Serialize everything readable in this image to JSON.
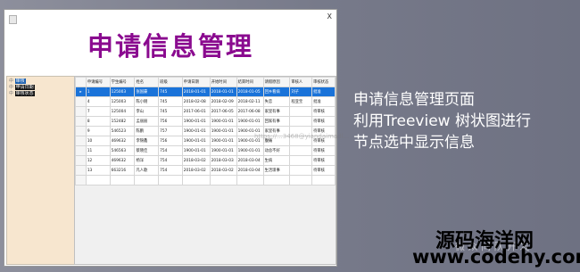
{
  "window": {
    "close_glyph": "X",
    "banner_title": "申请信息管理"
  },
  "tree": {
    "nodes": [
      {
        "label": "审核",
        "prefix": "中"
      },
      {
        "label": "申请日期",
        "prefix": "中"
      },
      {
        "label": "审核状态",
        "prefix": "中"
      }
    ]
  },
  "table": {
    "columns": [
      "申请编号",
      "学生编号",
      "姓名",
      "班级",
      "申请日期",
      "开始时间",
      "结束时间",
      "请假原因",
      "审核人",
      "审核状态"
    ],
    "rows": [
      {
        "selected": true,
        "marker": "▸",
        "cells": [
          "1",
          "125003",
          "张国豪",
          "745",
          "2018-01-01",
          "2018-01-01",
          "2018-01-05",
          "回乡看病",
          "刘子",
          "批准"
        ]
      },
      {
        "selected": false,
        "marker": "",
        "cells": [
          "4",
          "125003",
          "陈小刚",
          "745",
          "2018-02-08",
          "2018-02-09",
          "2018-02-11",
          "失恋",
          "程亚宝",
          "批准"
        ]
      },
      {
        "selected": false,
        "marker": "",
        "cells": [
          "7",
          "125004",
          "李山",
          "745",
          "2017-06-01",
          "2017-06-05",
          "2017-06-08",
          "家里有事",
          "",
          "待审核"
        ]
      },
      {
        "selected": false,
        "marker": "",
        "cells": [
          "8",
          "152482",
          "孟丽丽",
          "756",
          "1900-01-01",
          "1900-01-01",
          "1900-01-01",
          "回家有事",
          "",
          "待审核"
        ]
      },
      {
        "selected": false,
        "marker": "",
        "cells": [
          "9",
          "546523",
          "陈鹏",
          "757",
          "1900-01-01",
          "1900-01-01",
          "1900-01-01",
          "家里有事",
          "",
          "待审核"
        ]
      },
      {
        "selected": false,
        "marker": "",
        "cells": [
          "10",
          "469632",
          "李锦鑫",
          "756",
          "1900-01-01",
          "1900-01-01",
          "1900-01-01",
          "腹痛",
          "",
          "待审核"
        ]
      },
      {
        "selected": false,
        "marker": "",
        "cells": [
          "11",
          "546563",
          "蔡晓佳",
          "754",
          "1900-01-01",
          "1900-01-01",
          "1900-01-01",
          "动总不好",
          "",
          "待审核"
        ]
      },
      {
        "selected": false,
        "marker": "",
        "cells": [
          "12",
          "469632",
          "杨洋",
          "754",
          "2018-03-02",
          "2018-03-03",
          "2018-03-04",
          "生病",
          "",
          "待审核"
        ]
      },
      {
        "selected": false,
        "marker": "",
        "cells": [
          "13",
          "663216",
          "凡人歌",
          "754",
          "2018-03-02",
          "2018-03-02",
          "2018-03-04",
          "生活琐事",
          "",
          "待审核"
        ]
      },
      {
        "selected": false,
        "marker": "",
        "cells": [
          "",
          "",
          "",
          "",
          "",
          "",
          "",
          "",
          "",
          ""
        ]
      }
    ]
  },
  "watermark": "https://...3468@yiandaimadl...",
  "description": {
    "lines": [
      "申请信息管理页面",
      "利用Treeview 树状图进行",
      "节点选中显示信息"
    ]
  },
  "brand": {
    "name": "源码海洋网",
    "url": "www.codehy.com",
    "faint_text": "微 众 间 队 开 发"
  },
  "colors": {
    "title": "#8a0a8f",
    "selection": "#1a73d9",
    "tree_bg": "#f7e6cf"
  }
}
